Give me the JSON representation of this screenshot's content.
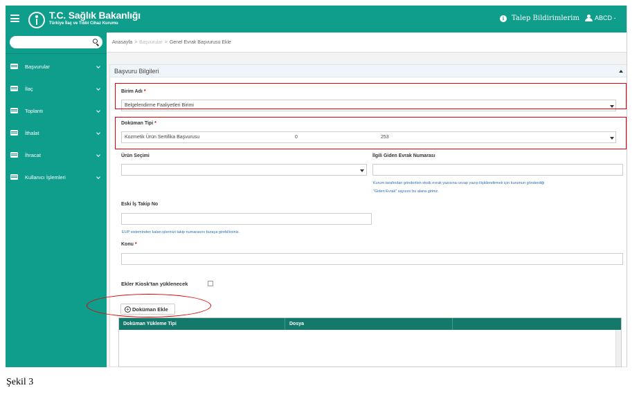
{
  "header": {
    "brand_title": "T.C. Sağlık Bakanlığı",
    "brand_subtitle": "Türkiye İlaç ve Tıbbi Cihaz Kurumu",
    "talep_label": "Talep Bildirimlerim",
    "user_label": "ABCD -"
  },
  "sidebar": {
    "search_placeholder": "",
    "items": [
      {
        "label": "Başvurular"
      },
      {
        "label": "İlaç"
      },
      {
        "label": "Toplantı"
      },
      {
        "label": "İthalat"
      },
      {
        "label": "İhracat"
      },
      {
        "label": "Kullanıcı İşlemleri"
      }
    ]
  },
  "breadcrumb": [
    "Anasayfa",
    "Başvurular",
    "Genel Evrak Başvurusu Ekle"
  ],
  "panel": {
    "title": "Başvuru Bilgileri"
  },
  "form": {
    "birim_label": "Birim Adı",
    "birim_value": "Belgelendirme Faaliyetleri Birimi",
    "dokuman_tipi_label": "Doküman Tipi",
    "dokuman_tipi_value": "Kozmetik Ürün Sertifika Başvurusu",
    "dokuman_tipi_col2": "0",
    "dokuman_tipi_col3": "253",
    "urun_label": "Ürün Seçimi",
    "urun_value": "",
    "giden_label": "İlgili Giden Evrak Numarası",
    "giden_value": "",
    "giden_help_1": "Kurum tarafından gönderilen eksik evrak yazısına cevap yazıp ilişkilendirmek için kurumun gönderdiği",
    "giden_help_2": "\"Giden Evrak\" sayısını bu alana giriniz.",
    "eski_label": "Eski İş Takip No",
    "eski_value": "",
    "eski_help": "EUP sisteminden kalan işlerinizi takip numarasını buraya girebilirsiniz.",
    "konu_label": "Konu",
    "konu_value": "",
    "required_mark": "*",
    "ekler_label": "Ekler Kiosk'tan yüklenecek",
    "ekler_checked": false,
    "add_doc_label": "Doküman Ekle",
    "plus_glyph": "+"
  },
  "table": {
    "columns": [
      "Doküman Yükleme Tipi",
      "Dosya",
      ""
    ]
  },
  "caption": "Şekil 3",
  "colors": {
    "brand": "#0f9d8c",
    "table_header": "#14786a",
    "highlight": "#e00000",
    "help_text": "#2c6fb8"
  },
  "icons": [
    "hamburger-icon",
    "ministry-logo-icon",
    "info-icon",
    "user-icon",
    "search-icon",
    "list-icon",
    "chevron-down-icon",
    "collapse-up-icon",
    "caret-down-icon",
    "plus-circle-icon"
  ]
}
